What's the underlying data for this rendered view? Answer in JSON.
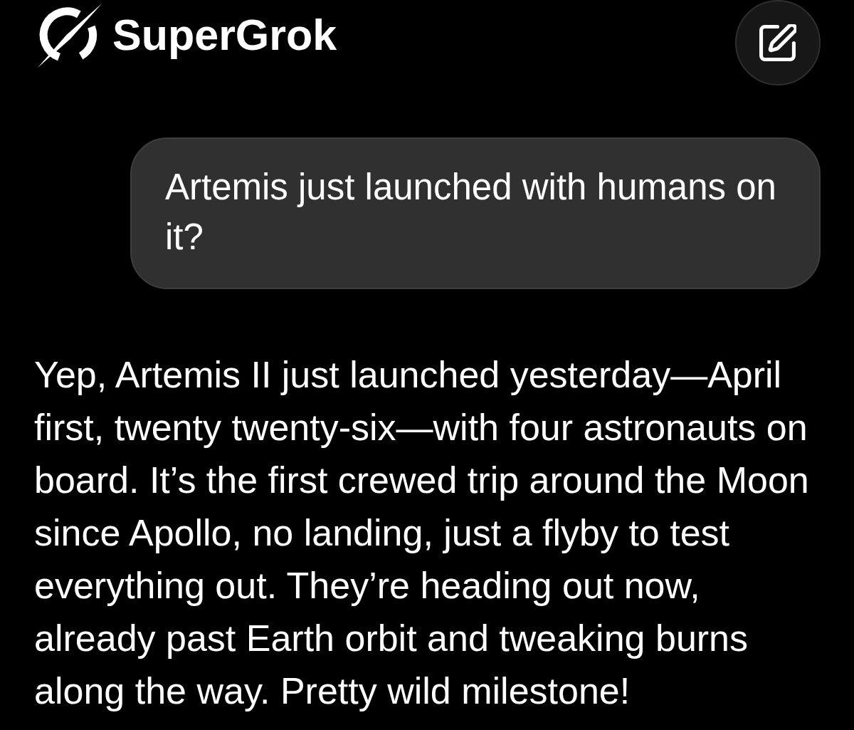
{
  "header": {
    "brand": "SuperGrok"
  },
  "conversation": [
    {
      "kind": "user",
      "text": "Artemis just launched with humans on it?"
    },
    {
      "kind": "assistant",
      "text": "Yep, Artemis II just launched yesterday—April first, twenty twenty-six—with four astronauts on board. It’s the first crewed trip around the Moon since Apollo, no landing, just a flyby to test everything out. They’re heading out now, already past Earth orbit and tweaking burns along the way. Pretty wild milestone!"
    }
  ]
}
